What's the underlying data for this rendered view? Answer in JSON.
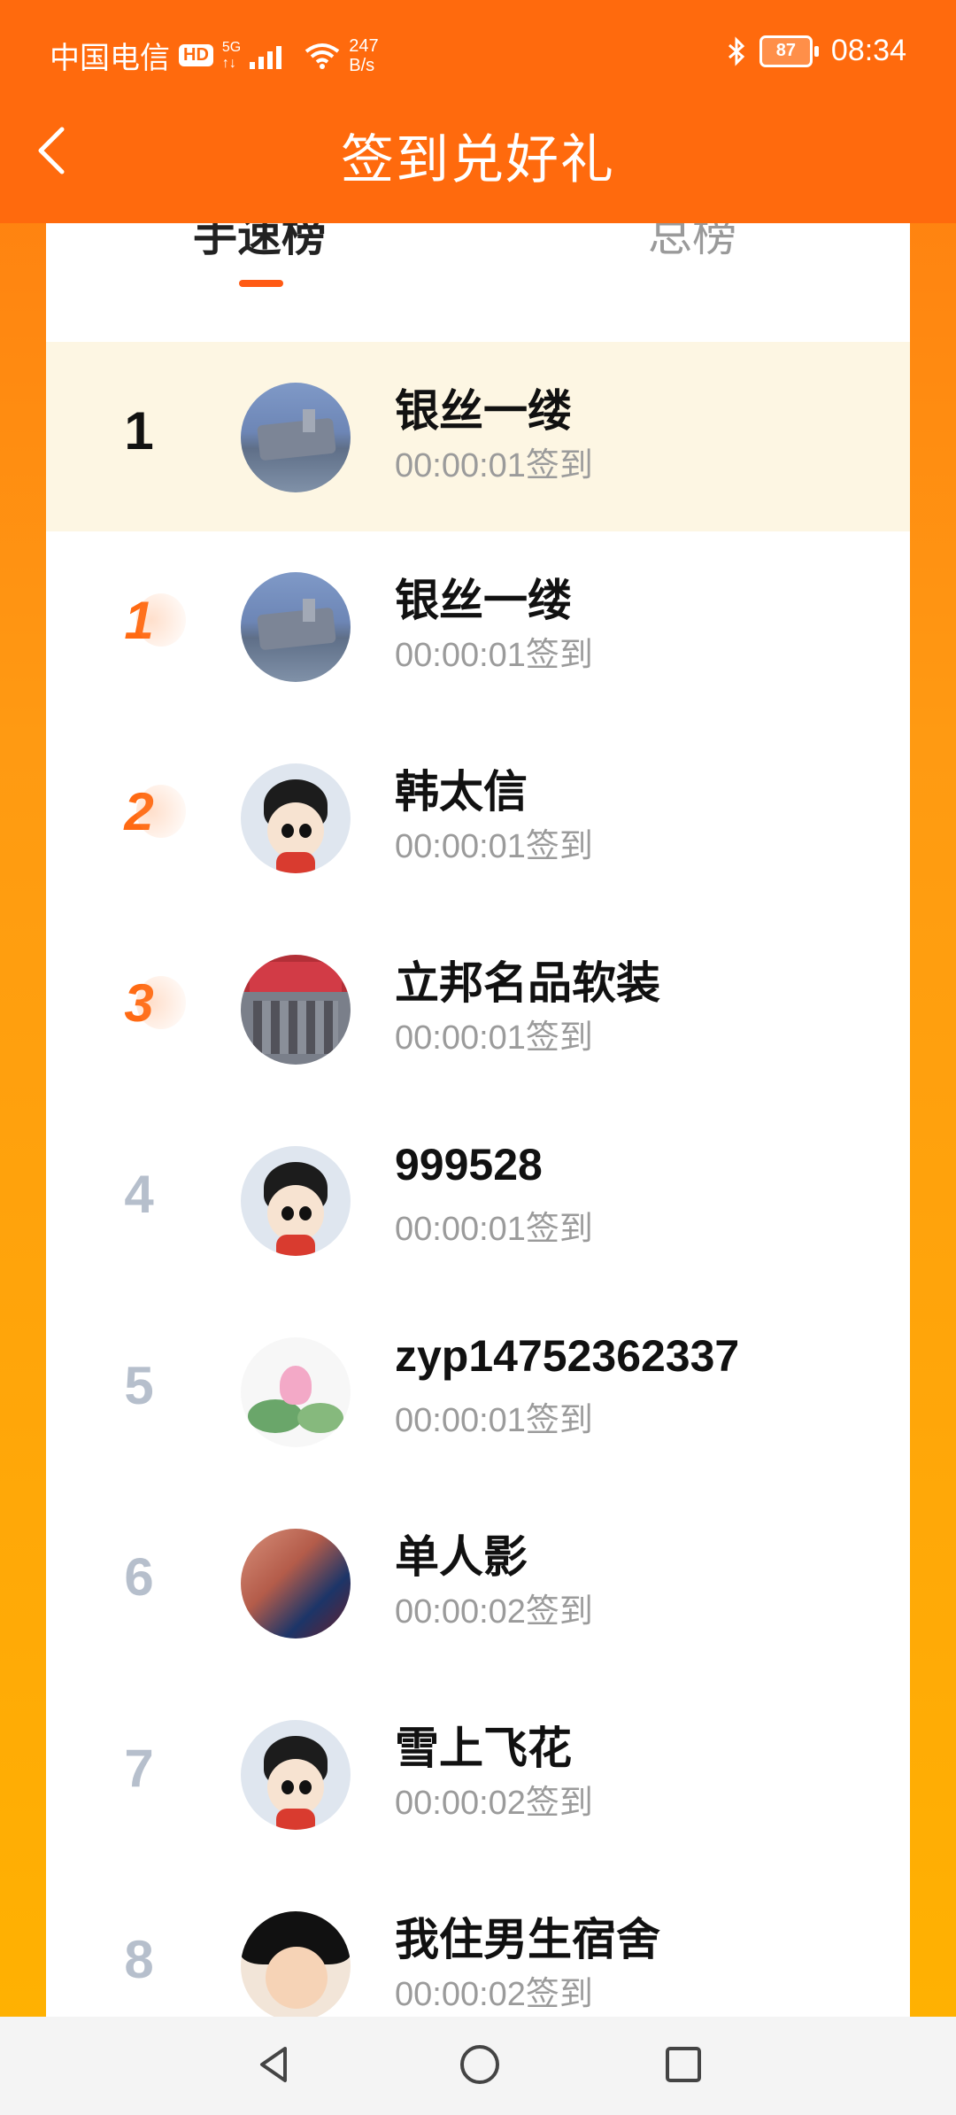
{
  "status_bar": {
    "carrier": "中国电信",
    "hd": "HD",
    "network": "5G",
    "net_sub": "↑↓",
    "speed_value": "247",
    "speed_unit": "B/s",
    "battery": "87",
    "time": "08:34"
  },
  "header": {
    "title": "签到兑好礼"
  },
  "tabs": [
    {
      "label": "手速榜",
      "active": true
    },
    {
      "label": "总榜",
      "active": false
    }
  ],
  "me": {
    "rank": "1",
    "name": "银丝一缕",
    "time": "00:00:01签到",
    "avatar_icon": "warship-avatar"
  },
  "rows": [
    {
      "rank": "1",
      "name": "银丝一缕",
      "time": "00:00:01签到",
      "avatar_icon": "warship-avatar"
    },
    {
      "rank": "2",
      "name": "韩太信",
      "time": "00:00:01签到",
      "avatar_icon": "cartoon-girl-avatar"
    },
    {
      "rank": "3",
      "name": "立邦名品软装",
      "time": "00:00:01签到",
      "avatar_icon": "storefront-avatar"
    },
    {
      "rank": "4",
      "name": "999528",
      "time": "00:00:01签到",
      "avatar_icon": "cartoon-girl-avatar"
    },
    {
      "rank": "5",
      "name": "zyp14752362337",
      "time": "00:00:01签到",
      "avatar_icon": "lotus-avatar"
    },
    {
      "rank": "6",
      "name": "单人影",
      "time": "00:00:02签到",
      "avatar_icon": "football-player-avatar"
    },
    {
      "rank": "7",
      "name": "雪上飞花",
      "time": "00:00:02签到",
      "avatar_icon": "cartoon-girl-avatar"
    },
    {
      "rank": "8",
      "name": "我住男生宿舍",
      "time": "00:00:02签到",
      "avatar_icon": "baby-avatar"
    }
  ],
  "colors": {
    "header": "#ff6a0d",
    "accent": "#ff5a14",
    "highlight_row": "#fdf6e3",
    "rank_muted": "#b6bfcc"
  }
}
